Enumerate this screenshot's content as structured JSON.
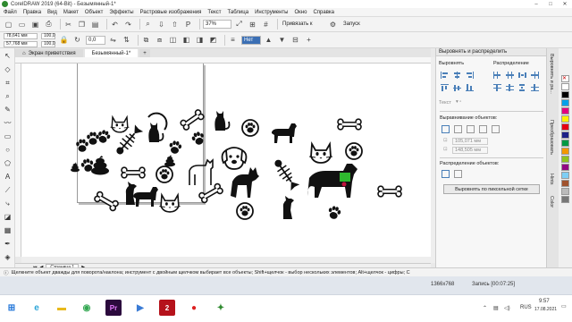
{
  "window": {
    "title": "CorelDRAW 2019 (64-Bit) - Безымянный-1*",
    "minimize": "–",
    "maximize": "□",
    "close": "✕"
  },
  "menu": {
    "items": [
      "Файл",
      "Правка",
      "Вид",
      "Макет",
      "Объект",
      "Эффекты",
      "Растровые изображения",
      "Текст",
      "Таблица",
      "Инструменты",
      "Окно",
      "Справка"
    ]
  },
  "toolbar": {
    "zoom_value": "37%",
    "snap_label": "Привязать к",
    "launch_label": "Запуск"
  },
  "property_bar": {
    "width_value": "78,641 мм",
    "height_value": "57,768 мм",
    "x_value": "100,0",
    "y_value": "100,0",
    "angle_value": "0,0",
    "outline_label": "Нет"
  },
  "doc_tabs": {
    "welcome": "Экран приветствия",
    "doc": "Безымянный-1*"
  },
  "page_bar": {
    "label": "Страница 1"
  },
  "panel": {
    "title": "Выровнять и распределить",
    "align_label": "Выровнять",
    "distribute_label": "Распределение",
    "text_label": "Текст",
    "align_objects_label": "Выравнивание объектов:",
    "x_value": "105,071 мм",
    "y_value": "148,505 мм",
    "distribute_objects_label": "Распределение объектов:",
    "pixel_grid_button": "Выровнять по пиксельной сетке"
  },
  "side_tabs": {
    "tab1": "Выровнять и ра...",
    "tab2": "Преобразовать",
    "tab3": "Hints",
    "tab4": "Color"
  },
  "statusbar": {
    "text": "Щелкните объект дважды для поворота/наклона; инструмент с двойным щелчком выбирает все объекты; Shift+щелчок - выбор нескольких элементов; Alt+щелчок - цифры; C"
  },
  "taskbar": {
    "resolution": "1366x768",
    "recording": "Запись [00:07:25]",
    "language": "RUS",
    "time": "9:57",
    "date": "17.08.2021"
  },
  "colors": {
    "accent": "#4a7fb8",
    "cat_collar": "#2fb82f",
    "collar_tag": "#c0143c"
  }
}
